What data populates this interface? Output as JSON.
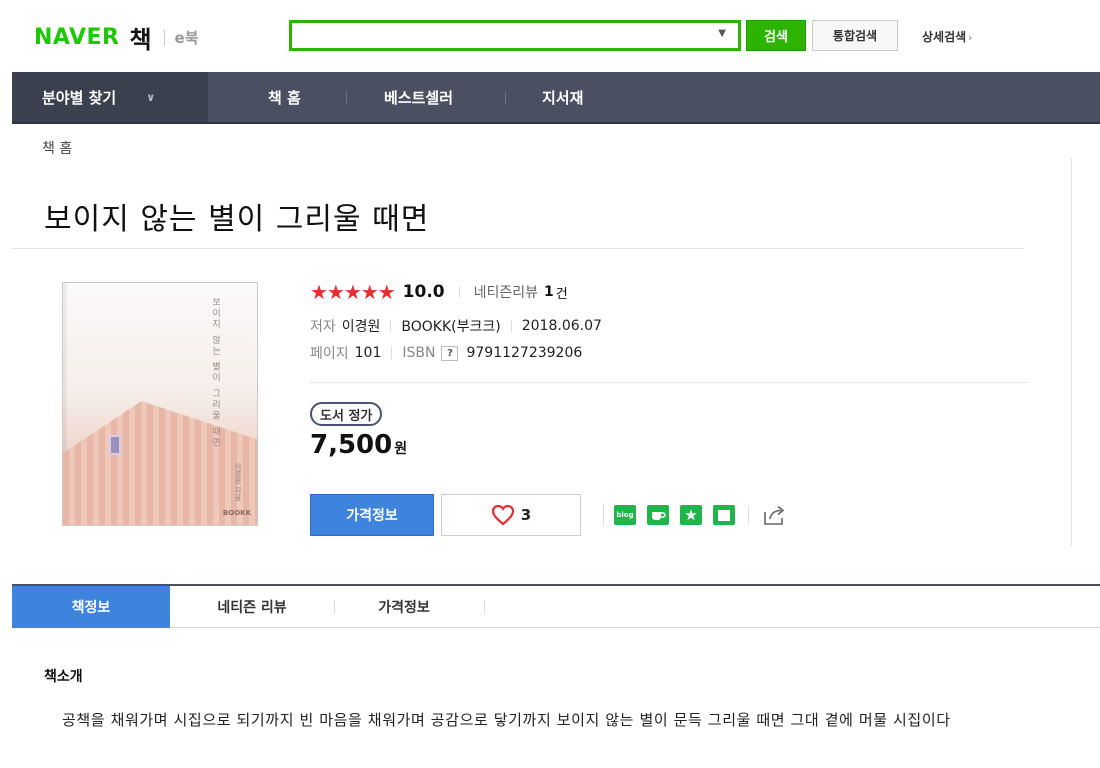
{
  "header": {
    "logo_naver": "NAVER",
    "logo_book": "책",
    "logo_ebook": "e북",
    "search": {
      "value": "",
      "placeholder": ""
    },
    "search_button": "검색",
    "total_search_button": "통합검색",
    "detail_search": "상세검색",
    "brand_color": "#2db400"
  },
  "gnb": {
    "category": "분야별 찾기",
    "items": [
      "책 홈",
      "베스트셀러",
      "지서재"
    ]
  },
  "breadcrumb": "책 홈",
  "book": {
    "title": "보이지 않는 별이 그리울 때면",
    "rating_stars": "★★★★★",
    "rating": "10.0",
    "review_label": "네티즌리뷰",
    "review_count": "1",
    "review_unit": "건",
    "author_label": "저자",
    "author": "이경원",
    "publisher": "BOOKK(부크크)",
    "date": "2018.06.07",
    "pages_label": "페이지",
    "pages": "101",
    "isbn_label": "ISBN",
    "isbn_help": "?",
    "isbn": "9791127239206",
    "price_badge": "도서 정가",
    "price": "7,500",
    "price_unit": "원",
    "price_info_button": "가격정보",
    "like_count": "3",
    "cover": {
      "title": "보이지 않는 별이 그리울 때면",
      "author": "이경원 지음",
      "publisher": "BOOKK"
    }
  },
  "share": {
    "icons": [
      "blog-icon",
      "cafe-icon",
      "bookmark-star-icon",
      "memo-icon",
      "share-out-icon"
    ],
    "blog_text": "blog",
    "colors": {
      "green": "#20b44a"
    }
  },
  "tabs": [
    "책정보",
    "네티즌 리뷰",
    "가격정보"
  ],
  "intro": {
    "title": "책소개",
    "text": "공책을 채워가며 시집으로 되기까지 빈 마음을 채워가며 공감으로 닿기까지 보이지 않는 별이 문득 그리울 때면 그대 곁에 머물 시집이다"
  }
}
